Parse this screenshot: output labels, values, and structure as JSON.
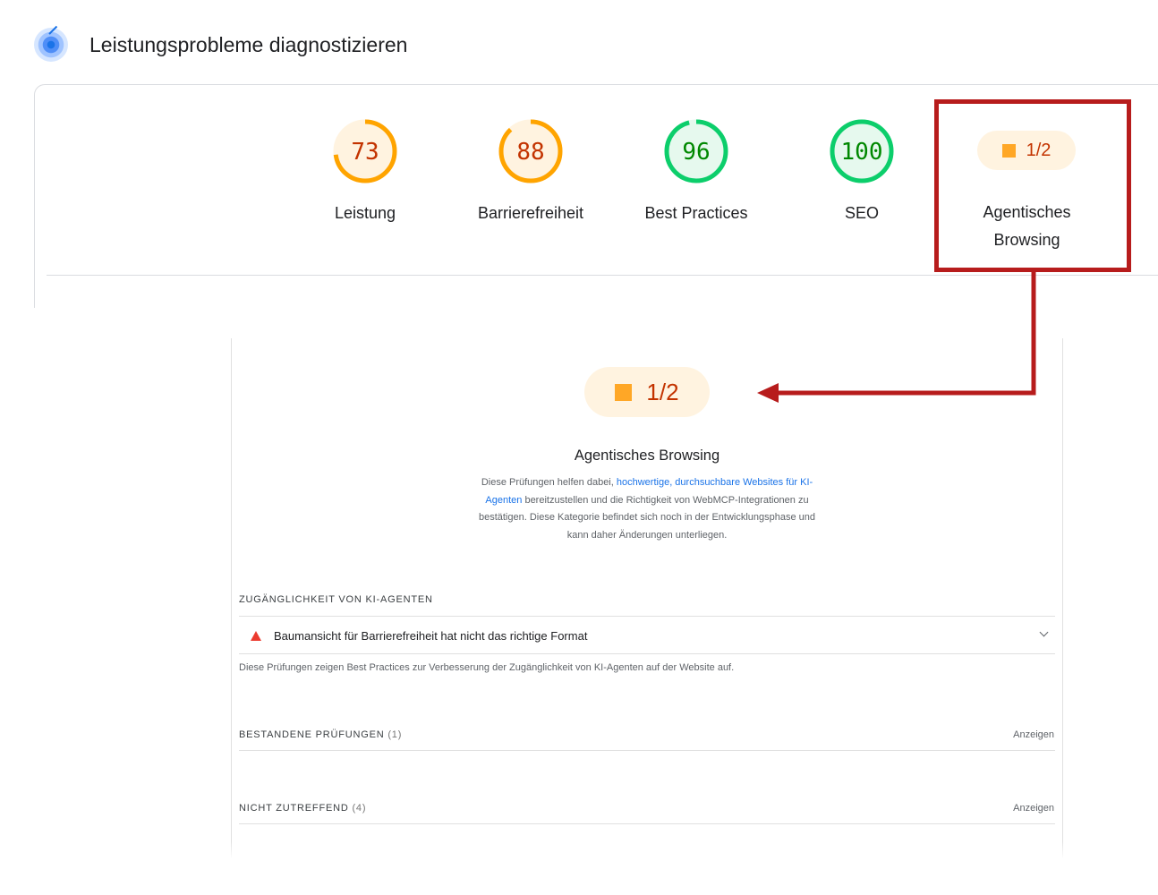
{
  "header": {
    "title": "Leistungsprobleme diagnostizieren",
    "logo_icon": "lighthouse-icon"
  },
  "colors": {
    "average": "#ffa400",
    "average_text": "#c33300",
    "pass": "#0cce6b",
    "pass_text": "#008800",
    "highlight": "#b71c1c",
    "link": "#1a73e8"
  },
  "gauges": [
    {
      "score": "73",
      "label": "Leistung",
      "fraction": 0.73,
      "status": "average"
    },
    {
      "score": "88",
      "label": "Barrierefreiheit",
      "fraction": 0.88,
      "status": "average"
    },
    {
      "score": "96",
      "label": "Best Practices",
      "fraction": 0.96,
      "status": "pass"
    },
    {
      "score": "100",
      "label": "SEO",
      "fraction": 1.0,
      "status": "pass"
    }
  ],
  "agentic": {
    "score": "1/2",
    "label_line1": "Agentisches",
    "label_line2": "Browsing",
    "icon": "square-icon"
  },
  "panel": {
    "score": "1/2",
    "title": "Agentisches Browsing",
    "desc_pre": "Diese Prüfungen helfen dabei, ",
    "desc_link": "hochwertige, durchsuchbare Websites für KI-Agenten",
    "desc_post": " bereitzustellen und die Richtigkeit von WebMCP-Integrationen zu bestätigen. Diese Kategorie befindet sich noch in der Entwicklungsphase und kann daher Änderungen unterliegen.",
    "section1": "ZUGÄNGLICHKEIT VON KI-AGENTEN",
    "audit_fail": "Baumansicht für Barrierefreiheit hat nicht das richtige Format",
    "audit_note": "Diese Prüfungen zeigen Best Practices zur Verbesserung der Zugänglichkeit von KI-Agenten auf der Website auf.",
    "passed_label": "BESTANDENE PRÜFUNGEN",
    "passed_count": "(1)",
    "na_label": "NICHT ZUTREFFEND",
    "na_count": "(4)",
    "show": "Anzeigen"
  }
}
